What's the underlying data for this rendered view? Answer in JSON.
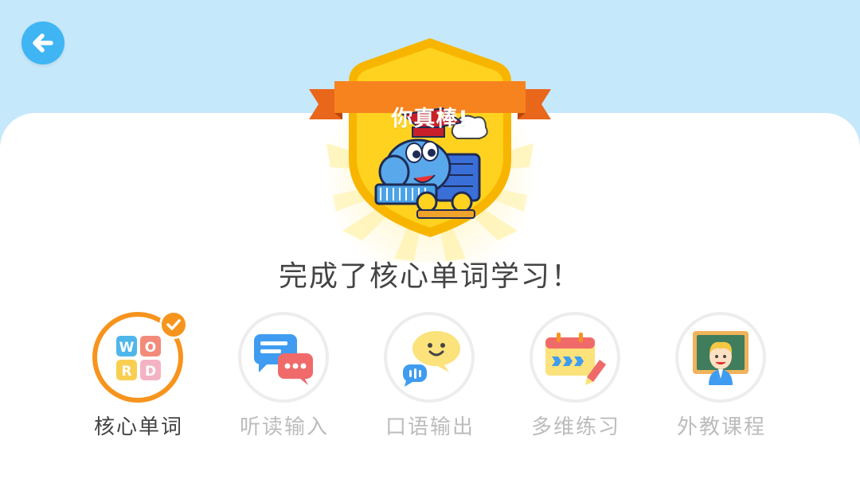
{
  "header": {
    "back_icon": "arrow-left-icon"
  },
  "badge": {
    "title": "你真棒!",
    "mascot_icon": "train-graduate-mascot-icon"
  },
  "headline": "完成了核心单词学习！",
  "modules": [
    {
      "label": "核心单词",
      "icon": "word-tiles-icon",
      "status": "completed",
      "tiles": [
        "W",
        "O",
        "R",
        "D"
      ]
    },
    {
      "label": "听读输入",
      "icon": "chat-bubbles-icon",
      "status": "locked"
    },
    {
      "label": "口语输出",
      "icon": "speech-bubble-face-icon",
      "status": "locked"
    },
    {
      "label": "多维练习",
      "icon": "calendar-pencil-icon",
      "status": "locked"
    },
    {
      "label": "外教课程",
      "icon": "teacher-blackboard-icon",
      "status": "locked"
    }
  ],
  "colors": {
    "sky": "#c6e8fb",
    "accent": "#f7941d",
    "back_button": "#3fb5f4",
    "inactive_text": "#bcbcbc",
    "active_text": "#444444"
  }
}
